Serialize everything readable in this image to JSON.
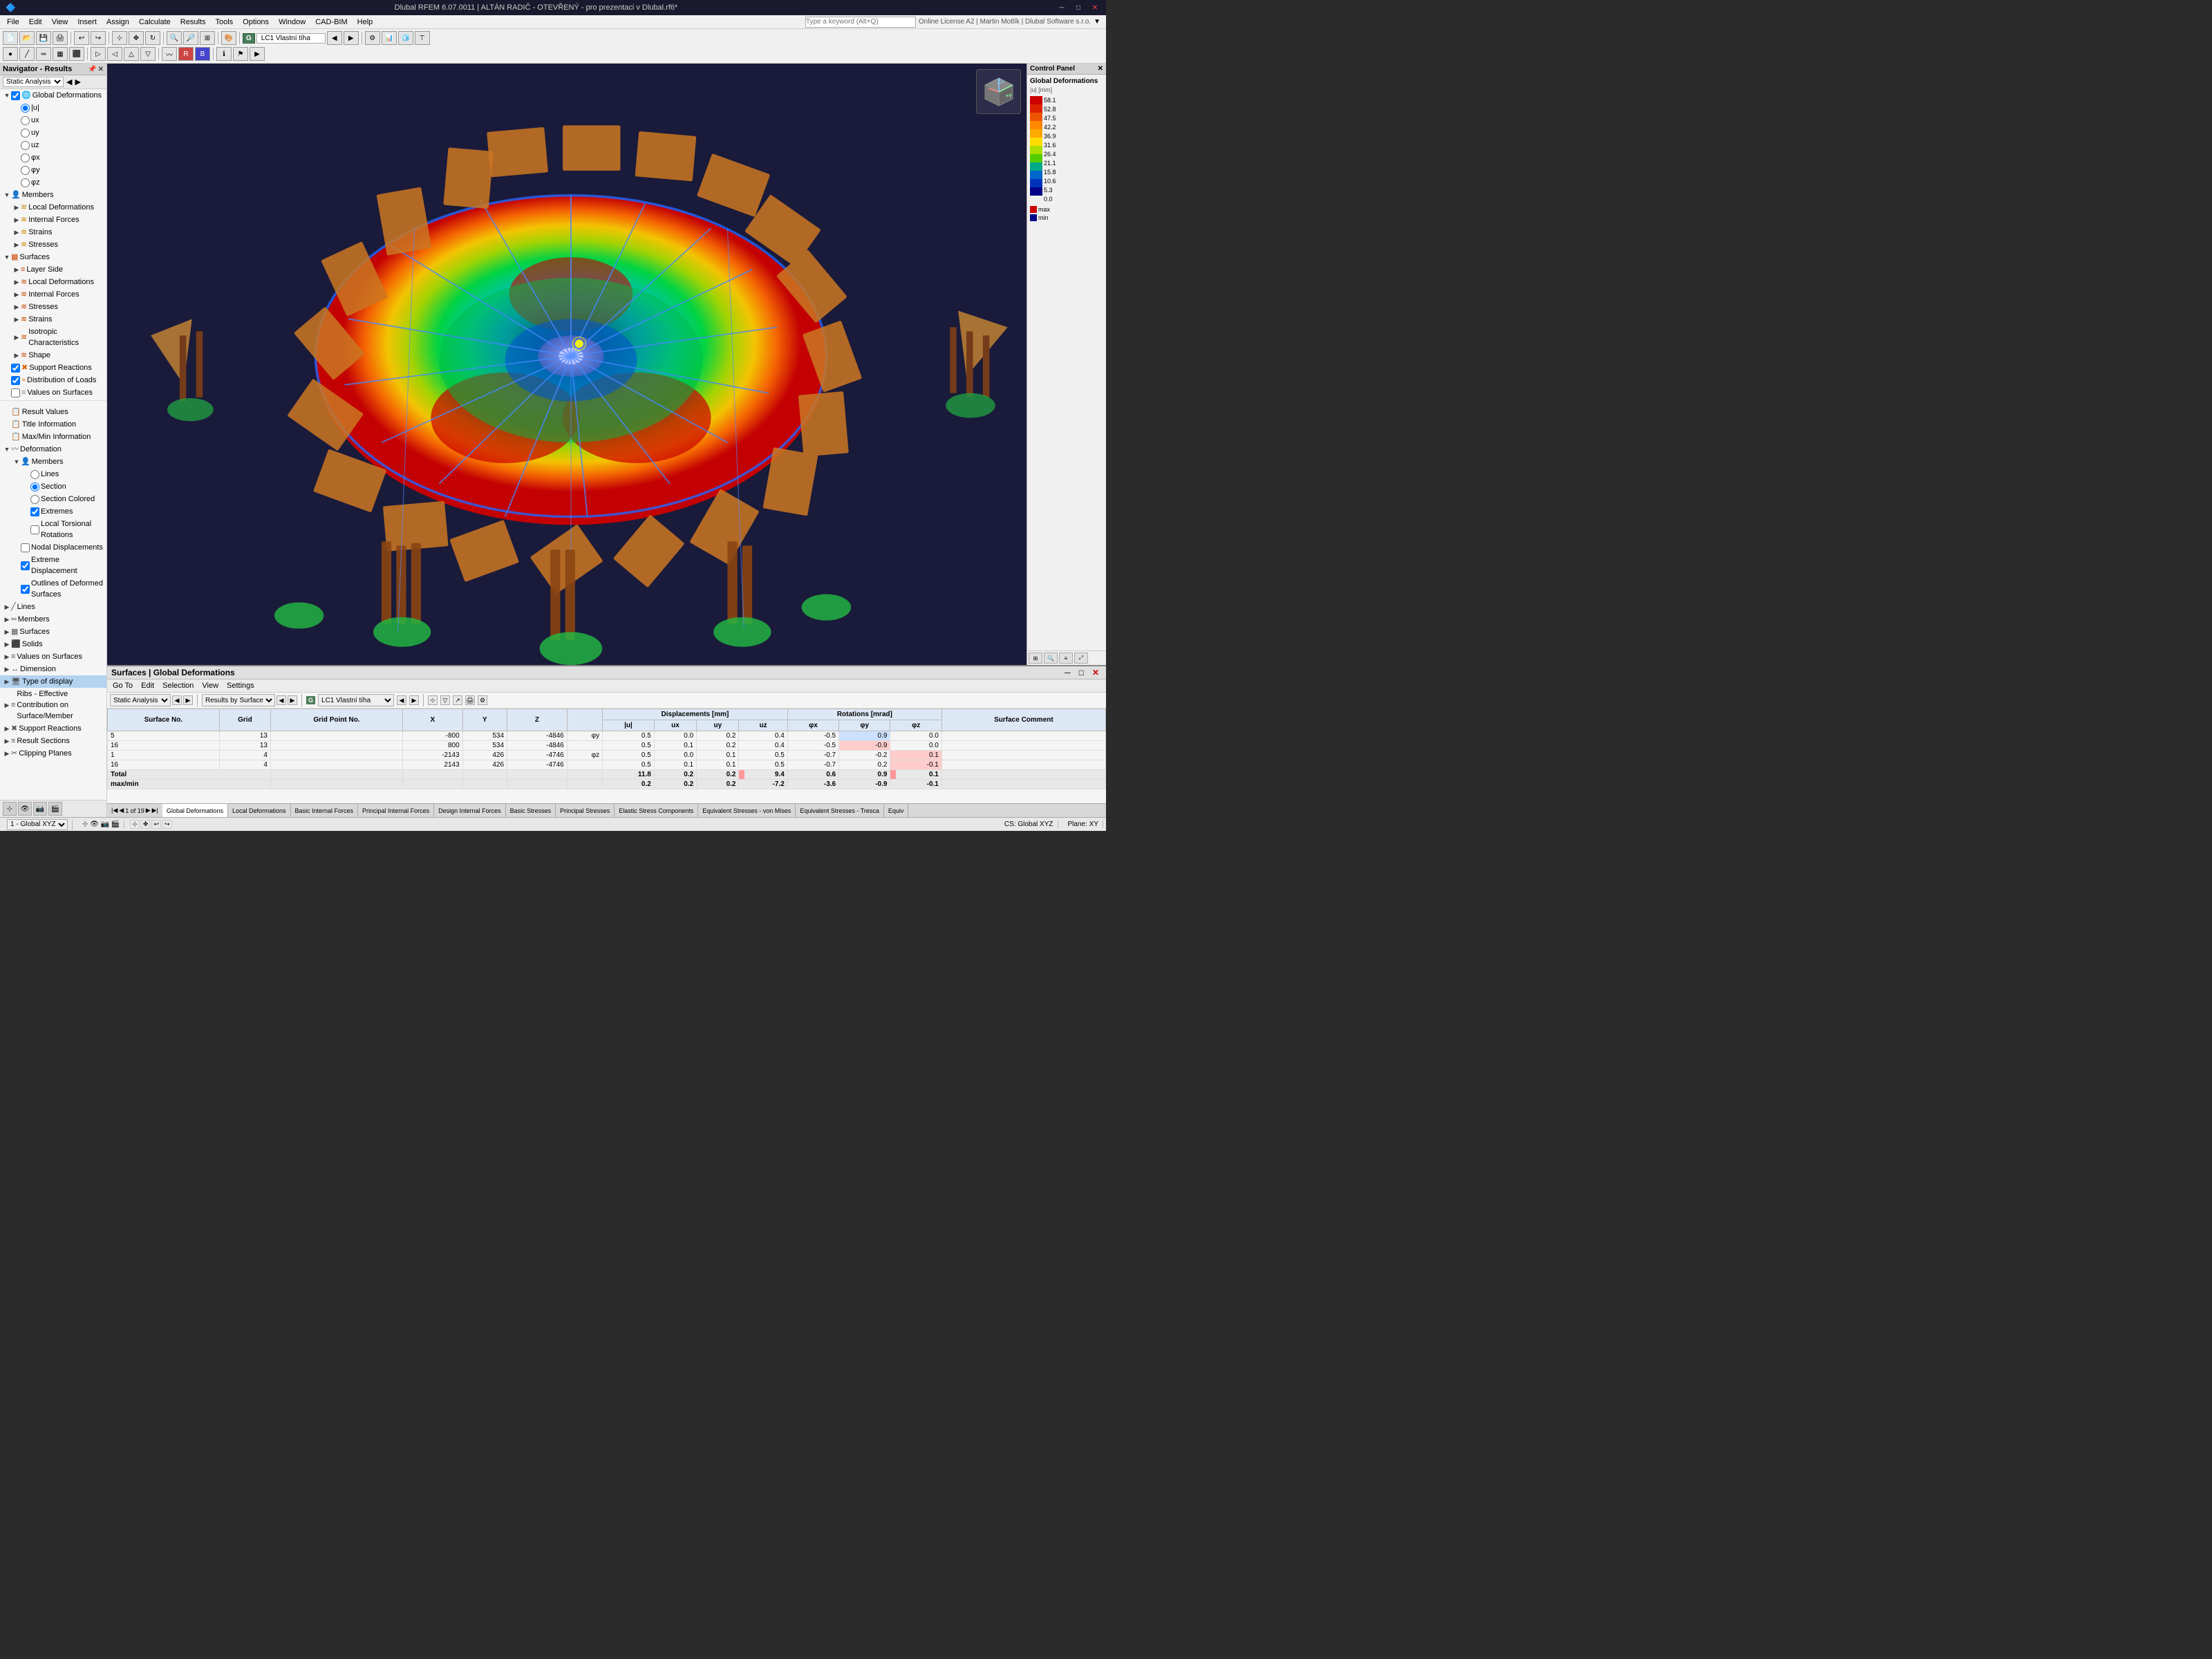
{
  "titlebar": {
    "title": "Dlubal RFEM 6.07.0011 | ALTÁN RADIČ - OTEVŘENÝ - pro prezentaci v Dlubal.rf6*",
    "minimize": "─",
    "maximize": "□",
    "close": "✕"
  },
  "menubar": {
    "items": [
      "File",
      "Edit",
      "View",
      "Insert",
      "Assign",
      "Calculate",
      "Results",
      "Tools",
      "Options",
      "Window",
      "CAD-BIM",
      "Help"
    ]
  },
  "navigator": {
    "title": "Navigator - Results",
    "dropdown": "Static Analysis",
    "tree": [
      {
        "label": "Global Deformations",
        "level": 0,
        "type": "group",
        "expanded": true,
        "checked": true,
        "icon": "globe"
      },
      {
        "label": "|u|",
        "level": 1,
        "type": "radio",
        "checked": true
      },
      {
        "label": "ux",
        "level": 1,
        "type": "radio",
        "checked": false
      },
      {
        "label": "uy",
        "level": 1,
        "type": "radio",
        "checked": false
      },
      {
        "label": "uz",
        "level": 1,
        "type": "radio",
        "checked": false
      },
      {
        "label": "φx",
        "level": 1,
        "type": "radio",
        "checked": false
      },
      {
        "label": "φy",
        "level": 1,
        "type": "radio",
        "checked": false
      },
      {
        "label": "φz",
        "level": 1,
        "type": "radio",
        "checked": false
      },
      {
        "label": "Members",
        "level": 0,
        "type": "group",
        "expanded": true,
        "checked": null,
        "icon": "member"
      },
      {
        "label": "Local Deformations",
        "level": 1,
        "type": "item"
      },
      {
        "label": "Internal Forces",
        "level": 1,
        "type": "item"
      },
      {
        "label": "Strains",
        "level": 1,
        "type": "item"
      },
      {
        "label": "Stresses",
        "level": 1,
        "type": "item"
      },
      {
        "label": "Surfaces",
        "level": 0,
        "type": "group",
        "expanded": true,
        "checked": null,
        "icon": "surface"
      },
      {
        "label": "Layer Side",
        "level": 1,
        "type": "item"
      },
      {
        "label": "Local Deformations",
        "level": 1,
        "type": "item"
      },
      {
        "label": "Internal Forces",
        "level": 1,
        "type": "item"
      },
      {
        "label": "Stresses",
        "level": 1,
        "type": "item"
      },
      {
        "label": "Strains",
        "level": 1,
        "type": "item"
      },
      {
        "label": "Isotropic Characteristics",
        "level": 1,
        "type": "item"
      },
      {
        "label": "Shape",
        "level": 1,
        "type": "item"
      },
      {
        "label": "Support Reactions",
        "level": 0,
        "type": "item",
        "checked": true
      },
      {
        "label": "Distribution of Loads",
        "level": 0,
        "type": "item",
        "checked": true
      },
      {
        "label": "Values on Surfaces",
        "level": 0,
        "type": "item",
        "checked": false
      },
      {
        "label": "",
        "level": 0,
        "type": "separator"
      },
      {
        "label": "Result Values",
        "level": 0,
        "type": "item"
      },
      {
        "label": "Title Information",
        "level": 0,
        "type": "item"
      },
      {
        "label": "Max/Min Information",
        "level": 0,
        "type": "item"
      },
      {
        "label": "Deformation",
        "level": 0,
        "type": "group",
        "expanded": true
      },
      {
        "label": "Members",
        "level": 1,
        "type": "group",
        "expanded": true
      },
      {
        "label": "Lines",
        "level": 2,
        "type": "radio",
        "checked": false
      },
      {
        "label": "Section",
        "level": 2,
        "type": "radio",
        "checked": true
      },
      {
        "label": "Section Colored",
        "level": 2,
        "type": "radio",
        "checked": false
      },
      {
        "label": "Extremes",
        "level": 2,
        "type": "check",
        "checked": true
      },
      {
        "label": "Local Torsional Rotations",
        "level": 2,
        "type": "check",
        "checked": false
      },
      {
        "label": "Nodal Displacements",
        "level": 1,
        "type": "check",
        "checked": false
      },
      {
        "label": "Extreme Displacement",
        "level": 1,
        "type": "check",
        "checked": true
      },
      {
        "label": "Outlines of Deformed Surfaces",
        "level": 1,
        "type": "check",
        "checked": true
      },
      {
        "label": "Lines",
        "level": 0,
        "type": "item"
      },
      {
        "label": "Members",
        "level": 0,
        "type": "item"
      },
      {
        "label": "Surfaces",
        "level": 0,
        "type": "item"
      },
      {
        "label": "Solids",
        "level": 0,
        "type": "item"
      },
      {
        "label": "Values on Surfaces",
        "level": 0,
        "type": "item"
      },
      {
        "label": "Dimension",
        "level": 0,
        "type": "item"
      },
      {
        "label": "Type of display",
        "level": 0,
        "type": "item",
        "selected": true
      },
      {
        "label": "Ribs - Effective Contribution on Surface/Member",
        "level": 0,
        "type": "item"
      },
      {
        "label": "Support Reactions",
        "level": 0,
        "type": "item"
      },
      {
        "label": "Result Sections",
        "level": 0,
        "type": "item"
      },
      {
        "label": "Clipping Planes",
        "level": 0,
        "type": "item"
      }
    ]
  },
  "control_panel": {
    "title": "Control Panel",
    "close_btn": "✕",
    "section": "Global Deformations",
    "unit": "|u| [mm]",
    "scale_values": [
      "58.1",
      "52.8",
      "47.5",
      "42.2",
      "36.9",
      "31.6",
      "26.4",
      "21.1",
      "15.8",
      "10.6",
      "5.3",
      "0.0"
    ],
    "scale_colors": [
      "#cc0000",
      "#dd2200",
      "#ee5500",
      "#ff8800",
      "#ffaa00",
      "#ffdd00",
      "#aadd00",
      "#55cc00",
      "#00aa88",
      "#0066cc",
      "#0033bb",
      "#000088"
    ]
  },
  "results_panel": {
    "title": "Surfaces | Global Deformations",
    "menu_items": [
      "Go To",
      "Edit",
      "Selection",
      "View",
      "Settings"
    ],
    "close_btn": "✕",
    "filter_label": "Static Analysis",
    "filter_label2": "Results by Surface",
    "lc_indicator": "G",
    "lc_name": "LC1  Vlastní tíha",
    "table": {
      "headers": [
        "Surface No.",
        "Grid",
        "Grid Point No.",
        "X",
        "Y",
        "Z",
        "",
        "",
        "Displacements [mm]",
        "",
        "",
        "",
        "Rotations [mrad]",
        "",
        "",
        "Surface Comment"
      ],
      "subheaders": [
        "",
        "",
        "",
        "",
        "",
        "",
        "",
        "",
        "|u|",
        "ux",
        "uy",
        "uz",
        "φx",
        "φy",
        "φz",
        ""
      ],
      "rows": [
        {
          "surface": "5",
          "grid": "13",
          "point": "",
          "x": "-800",
          "y": "534",
          "z": "-4846",
          "note": "φy",
          "abs": "0.5",
          "ux": "0.0",
          "uy": "0.2",
          "uz": "0.4",
          "px": "-0.5",
          "py": "0.9",
          "pz": "0.0",
          "flag": "blue"
        },
        {
          "surface": "16",
          "grid": "13",
          "point": "",
          "x": "800",
          "y": "534",
          "z": "-4846",
          "note": "",
          "abs": "0.5",
          "ux": "0.1",
          "uy": "0.2",
          "uz": "0.4",
          "px": "-0.5",
          "py": "-0.9",
          "pz": "0.0",
          "flag": "red"
        },
        {
          "surface": "1",
          "grid": "4",
          "point": "",
          "x": "-2143",
          "y": "426",
          "z": "-4746",
          "note": "φz",
          "abs": "0.5",
          "ux": "0.0",
          "uy": "0.1",
          "uz": "0.5",
          "px": "-0.7",
          "py": "-0.2",
          "pz": "0.1",
          "flag": "red"
        },
        {
          "surface": "16",
          "grid": "4",
          "point": "",
          "x": "2143",
          "y": "426",
          "z": "-4746",
          "note": "",
          "abs": "0.5",
          "ux": "0.1",
          "uy": "0.1",
          "uz": "0.5",
          "px": "-0.7",
          "py": "0.2",
          "pz": "-0.1",
          "flag": "red"
        }
      ],
      "total_row": {
        "label": "Total max/min",
        "abs_max": "11.8",
        "abs_min": "0.2",
        "ux_max": "0.2",
        "ux_min": "0.2",
        "uy_max": "0.2",
        "uy_min": "0.2",
        "uz_max": "9.4",
        "uz_min": "-7.2",
        "px_max": "0.6",
        "px_min": "-3.6",
        "py_max": "0.9",
        "py_min": "-0.9",
        "pz_max": "0.1",
        "pz_min": "-0.1"
      }
    },
    "pagination": "1 of 19"
  },
  "bottom_tabs": {
    "tabs": [
      "Global Deformations",
      "Local Deformations",
      "Basic Internal Forces",
      "Principal Internal Forces",
      "Design Internal Forces",
      "Basic Stresses",
      "Principal Stresses",
      "Elastic Stress Components",
      "Equivalent Stresses - von Mises",
      "Equivalent Stresses - Tresca",
      "Equiv"
    ],
    "active": "Global Deformations"
  },
  "statusbar": {
    "item1": "1 - Global XYZ",
    "item2": "CS: Global XYZ",
    "item3": "Plane: XY"
  },
  "toolbar": {
    "lc_indicator": "G",
    "lc_name": "LC1  Vlastní tíha"
  }
}
